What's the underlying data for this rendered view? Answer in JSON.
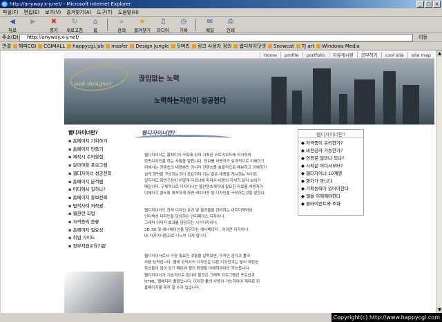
{
  "window": {
    "title": "http://anyway.x-y.net/ - Microsoft Internet Explorer",
    "min": "_",
    "max": "□",
    "close": "×"
  },
  "menu": [
    "파일(F)",
    "편집(E)",
    "보기(V)",
    "즐겨찾기(A)",
    "도구(T)",
    "도움말(H)"
  ],
  "toolbar": [
    {
      "icon": "back-arrow-icon",
      "label": "뒤로"
    },
    {
      "icon": "forward-arrow-icon",
      "label": ""
    },
    {
      "icon": "stop-icon",
      "label": "중지"
    },
    {
      "icon": "refresh-icon",
      "label": "새로고침"
    },
    {
      "icon": "home-icon",
      "label": "홈"
    },
    {
      "icon": "search-icon",
      "label": "검색"
    },
    {
      "icon": "favorites-icon",
      "label": "즐겨찾기"
    },
    {
      "icon": "media-icon",
      "label": "미디어"
    },
    {
      "icon": "history-icon",
      "label": "기록"
    },
    {
      "icon": "mail-icon",
      "label": "메일"
    },
    {
      "icon": "print-icon",
      "label": "인쇄"
    }
  ],
  "address": {
    "label": "주소(D)",
    "url": "http://anyway.x-y.net/",
    "go": "이동"
  },
  "links": {
    "label": "연결",
    "items": [
      "해피CGI",
      "CGIMALL",
      "happycgi.job",
      "masfer",
      "Design Jungle",
      "닷머리",
      "링크 사용자 정의",
      "웹디자이닷넷",
      "Snowcat",
      "TJ art",
      "Windows Media"
    ]
  },
  "site": {
    "topnav": [
      "Home",
      "profile",
      "portfolio",
      "자유게시판",
      "공부하기",
      "cool site",
      "site map"
    ],
    "banner": {
      "logo": "web designer",
      "line1": "끊임없는 노력",
      "line2": "노력하는자만이 성공한다"
    },
    "sidebar": {
      "title": "웹디자이너란?",
      "items": [
        "홈페이지 기획하기",
        "홈페이지 만들기",
        "제작시 주의할점",
        "알아야할 프로그램",
        "웹디자이너 성공전략",
        "홈페이지 분석법",
        "어디에서 일하나?",
        "홈페이지 홍보전략",
        "법적사례 저작권",
        "웹관련 직업",
        "자격증의 종류",
        "홈페이지 필요성",
        "취업 가이드",
        "정부지원교육기관"
      ]
    },
    "main": {
      "heading": "웹디자이너란?",
      "para1": "웹디자이너는 홈페이지 구축에 있어 기획된 스토리보드에 의거하여\n화면디자인을 하는 사람을 말합니다. 정보를 사용자가 효과적으로 이해하기\n위해서는 컨텐츠의 내용뿐만 아니라 컨텐츠를 효율적으로 배분하고 이해하기\n쉽게 화면을 구성하는것이 중요하다 이는 같은 내용을 게시하는 사이트\n일지라도 화면구성이 어떻게 다르냐에 따라서 내용의 가치가 달라 보이기\n때문이다. 구체적으로 디자이너는 웹컨텐츠제작에 필요한 자료를 사용자가\n이해하기 쉽도록 쾌적하게 화면 레이아웃 및 디자인을 구성하는것을 말한다.",
      "para2": "웹디자이너도 전체 디자인 효과 및 결과물을 관리하는 아트디렉터와\n인터랙션 디자인을 담당하는 인터페이스 디자이너 ,\n그래픽 이미지 효과를 담당하는 시각디자이너,\n2D,3D 및 애니메이션을 담당하는 애니메이터 , 아이콘 디자이너.\nUI 디자이너등으로 나누어 지게 됩니다",
      "para3": "웹디자이너로서 가장 필요한 것들을 살펴보면, 미적인 감각과 툴의\n사용 능력입니다. 웹에 있어서의 디자인은 다른 디자인과는 달리 제한된\n특성들이 많이 있기 때문에 웹의 환경을 이해하여야만 가능합니다.\n웹디자이너가 기본적으로 알아야 할것은 그래픽 프로그램인 포토샵과\nHTML, 웹에디터 툴들입니다. 이러한 툴의 사용이 가능하여야 제대로 된\n홈페이지를 제작 할 수가 있습니다."
    },
    "questions": {
      "title": "웹디자이너란?",
      "items": [
        "자격증이 유리한가?",
        "비전공자 가능한가?",
        "연봉은 얼마나 되나?",
        "시작은 어디서부터?",
        "웹디자이너 10계명",
        "화가가 아니다",
        "기획능력이 있어야한다",
        "웹을 이해해야한다",
        "클라이언트와 조화"
      ]
    }
  },
  "copyright": "Copyright(c) http://www.happycgi.com"
}
